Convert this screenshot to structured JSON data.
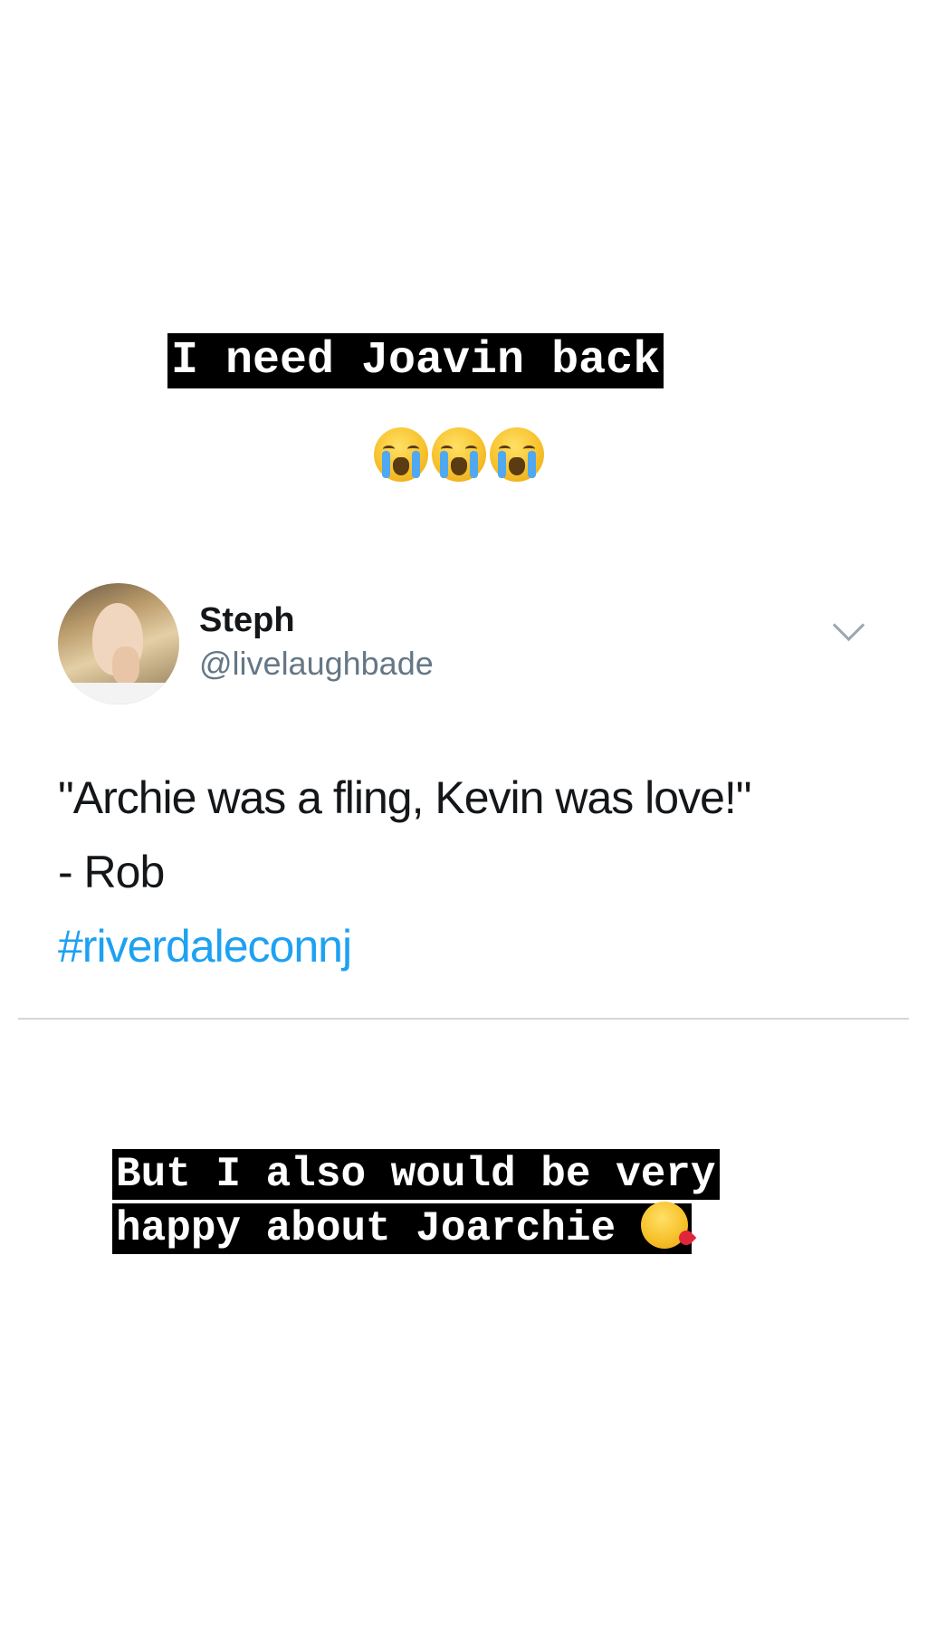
{
  "captions": {
    "top": "I need Joavin back",
    "bottom": "But I also would be very happy about Joarchie"
  },
  "emojis": {
    "top_row": [
      "loudly-crying-face",
      "loudly-crying-face",
      "loudly-crying-face"
    ],
    "bottom_inline": "face-blowing-a-kiss"
  },
  "tweet": {
    "display_name": "Steph",
    "handle": "@livelaughbade",
    "lines": [
      "\"Archie was a fling, Kevin was love!\"",
      "- Rob"
    ],
    "hashtag": "#riverdaleconnj"
  },
  "colors": {
    "caption_background": "#000000",
    "caption_text": "#ffffff",
    "hashtag": "#1da1f2",
    "handle": "#657786"
  }
}
